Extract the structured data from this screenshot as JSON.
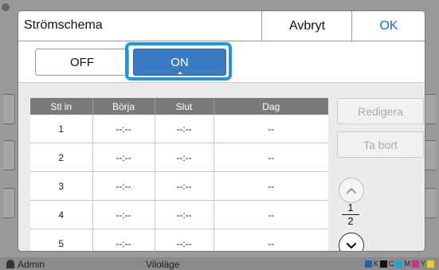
{
  "dialog": {
    "title": "Strömschema",
    "cancel_label": "Avbryt",
    "ok_label": "OK"
  },
  "toggle": {
    "off_label": "OFF",
    "on_label": "ON",
    "selected": "ON"
  },
  "table": {
    "columns": [
      "Stl in",
      "Börja",
      "Slut",
      "Dag"
    ],
    "rows": [
      [
        "1",
        "--:--",
        "--:--",
        "--"
      ],
      [
        "2",
        "--:--",
        "--:--",
        "--"
      ],
      [
        "3",
        "--:--",
        "--:--",
        "--"
      ],
      [
        "4",
        "--:--",
        "--:--",
        "--"
      ],
      [
        "5",
        "--:--",
        "--:--",
        "--"
      ]
    ]
  },
  "actions": {
    "edit_label": "Redigera",
    "delete_label": "Ta bort"
  },
  "pager": {
    "current": "1",
    "total": "2"
  },
  "status_bar": {
    "user": "Admin",
    "mode": "Viloläge",
    "ink_labels": [
      "K",
      "C",
      "M",
      "Y"
    ]
  },
  "colors": {
    "accent": "#3a7bc4",
    "highlight": "#1f96e0",
    "ok_text": "#1a6fc8"
  }
}
